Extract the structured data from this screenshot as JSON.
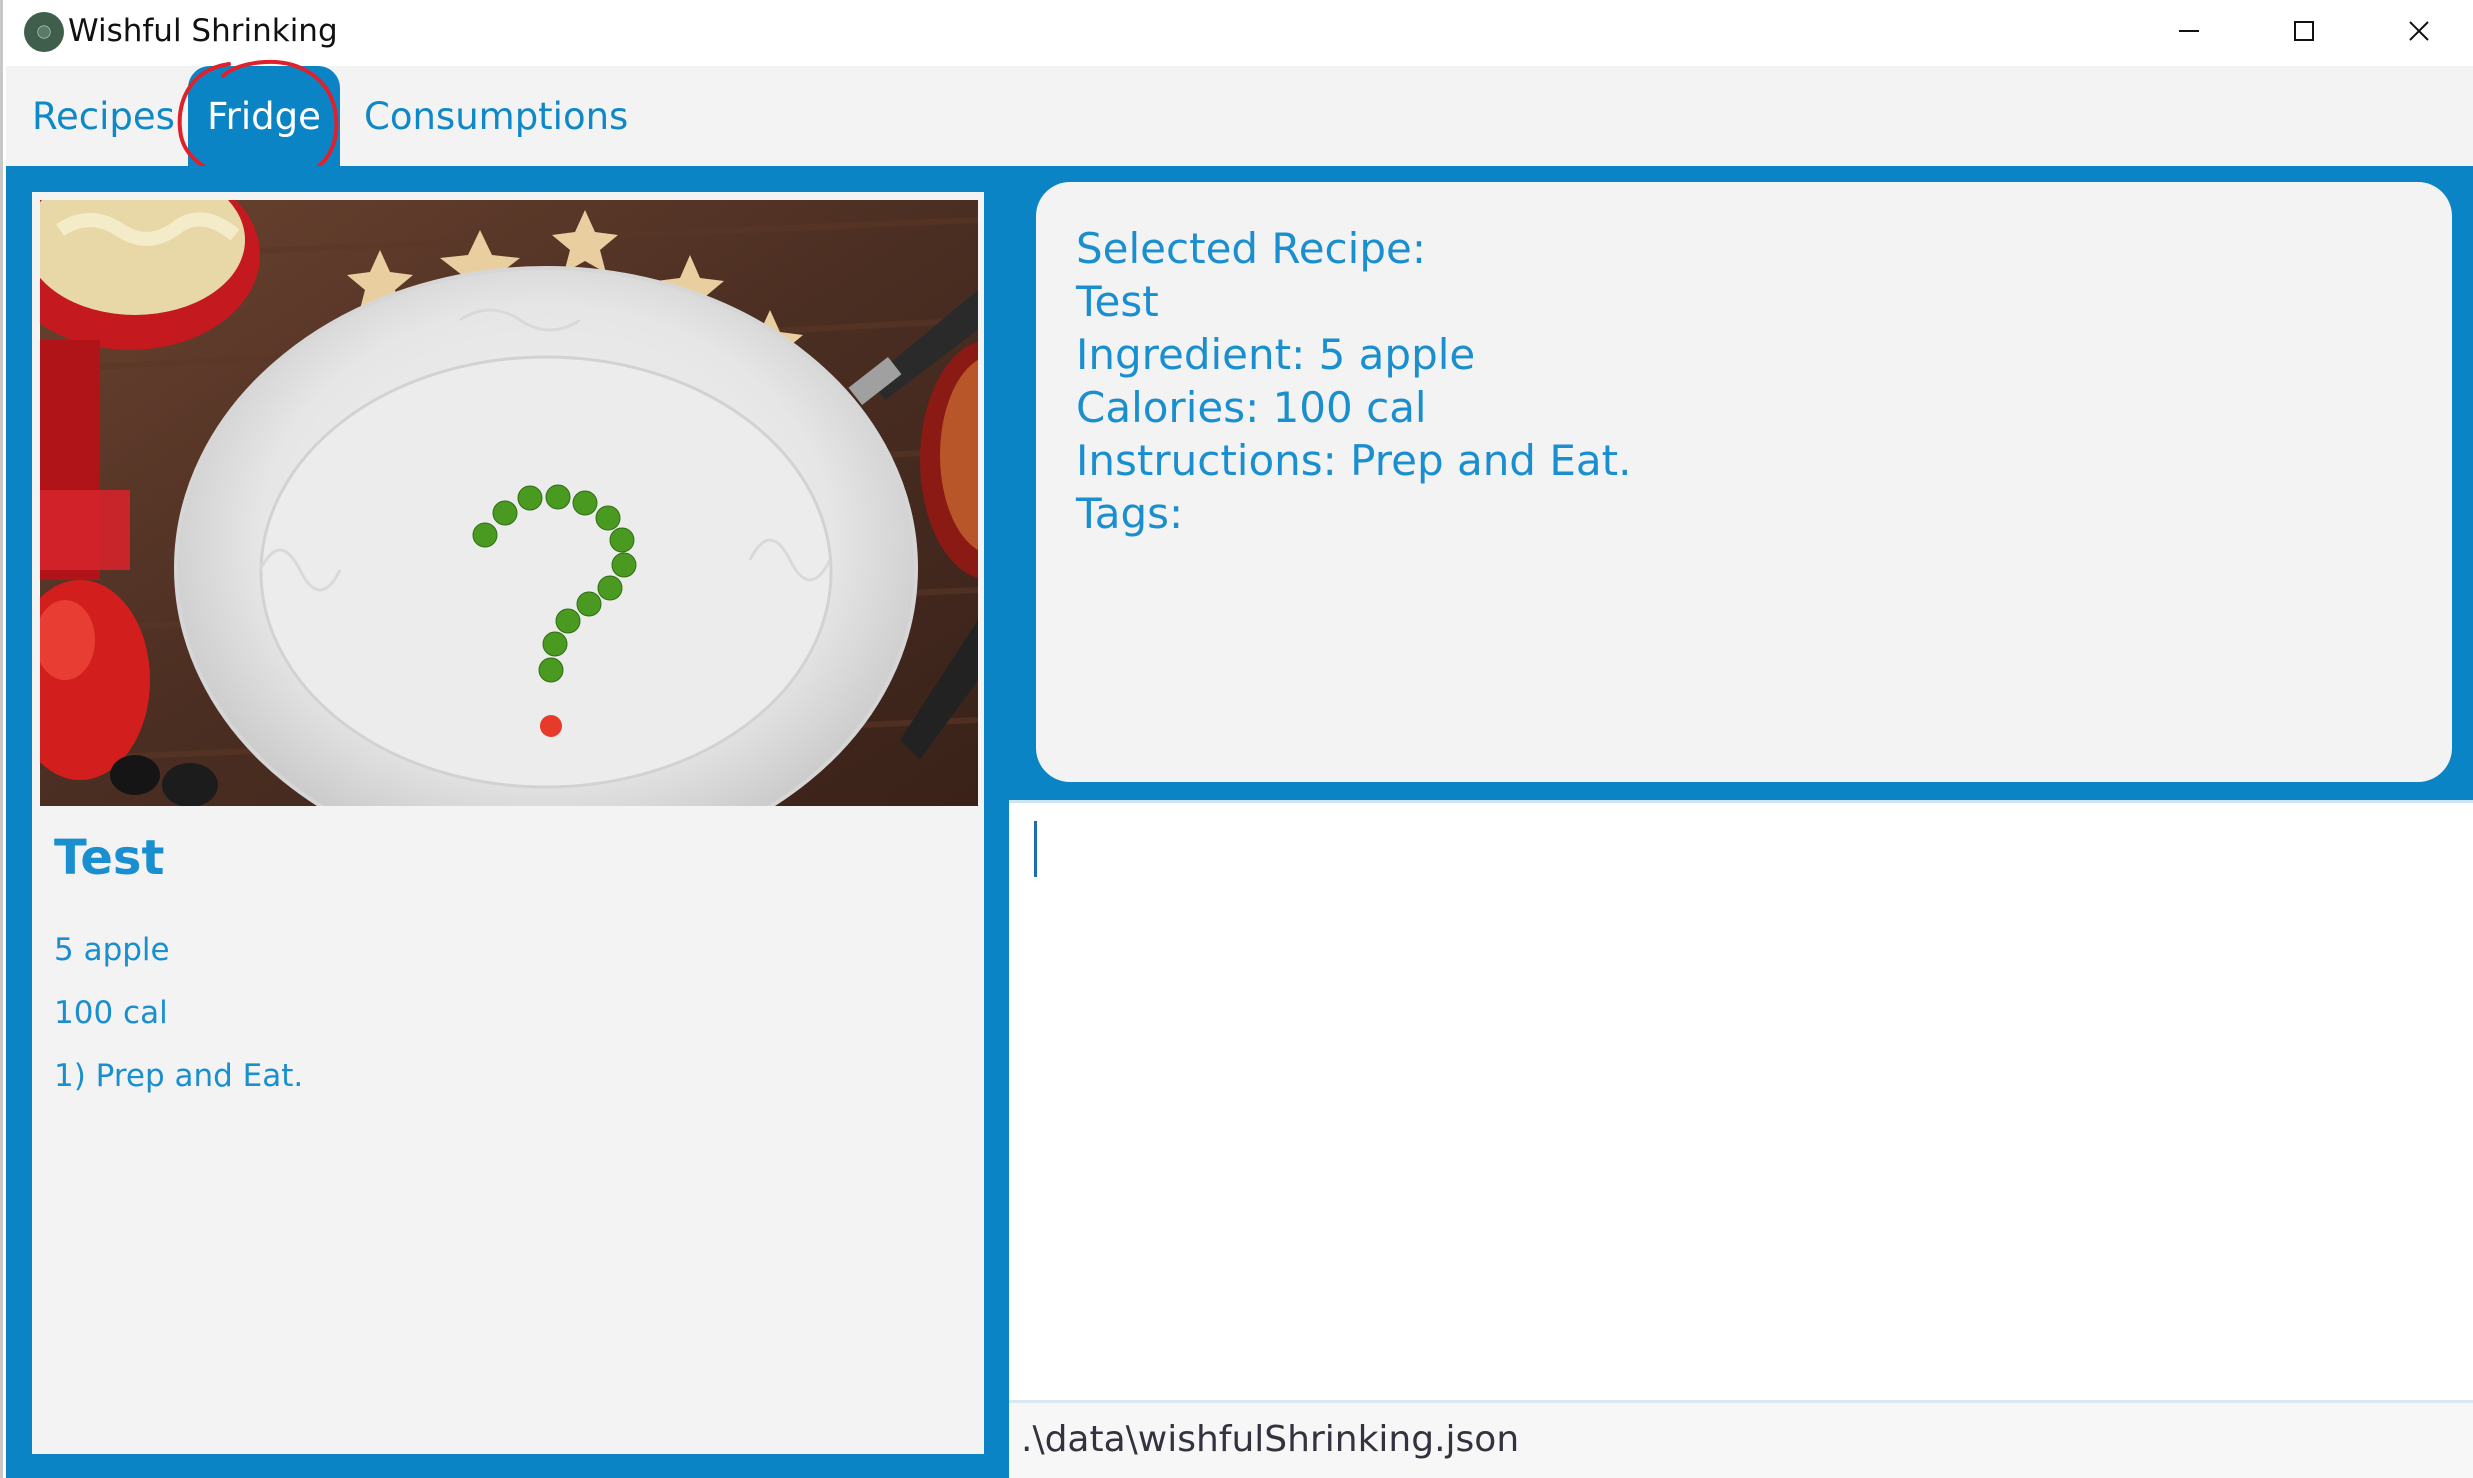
{
  "window": {
    "title": "Wishful Shrinking",
    "icons": [
      "app-icon",
      "minimize-icon",
      "maximize-icon",
      "close-icon"
    ]
  },
  "tabs": [
    {
      "label": "Recipes",
      "selected": false
    },
    {
      "label": "Fridge",
      "selected": true
    },
    {
      "label": "Consumptions",
      "selected": false
    }
  ],
  "colors": {
    "accent": "#0b84c6",
    "text_blue": "#1a8fd0",
    "annotation_red": "#e0202a"
  },
  "recipe_card": {
    "name": "Test",
    "ingredients": "5 apple",
    "calories": "100 cal",
    "instructions": "1) Prep and Eat.",
    "image_icon": "plate-with-peas-question-mark"
  },
  "selected_recipe": {
    "heading": "Selected Recipe:",
    "name": "Test",
    "ingredient": "Ingredient: 5 apple",
    "calories": "Calories: 100 cal",
    "instructions": "Instructions: Prep and Eat.",
    "tags": "Tags:"
  },
  "result_display": {
    "text": ""
  },
  "status_bar": {
    "file_path": ".\\data\\wishfulShrinking.json"
  }
}
